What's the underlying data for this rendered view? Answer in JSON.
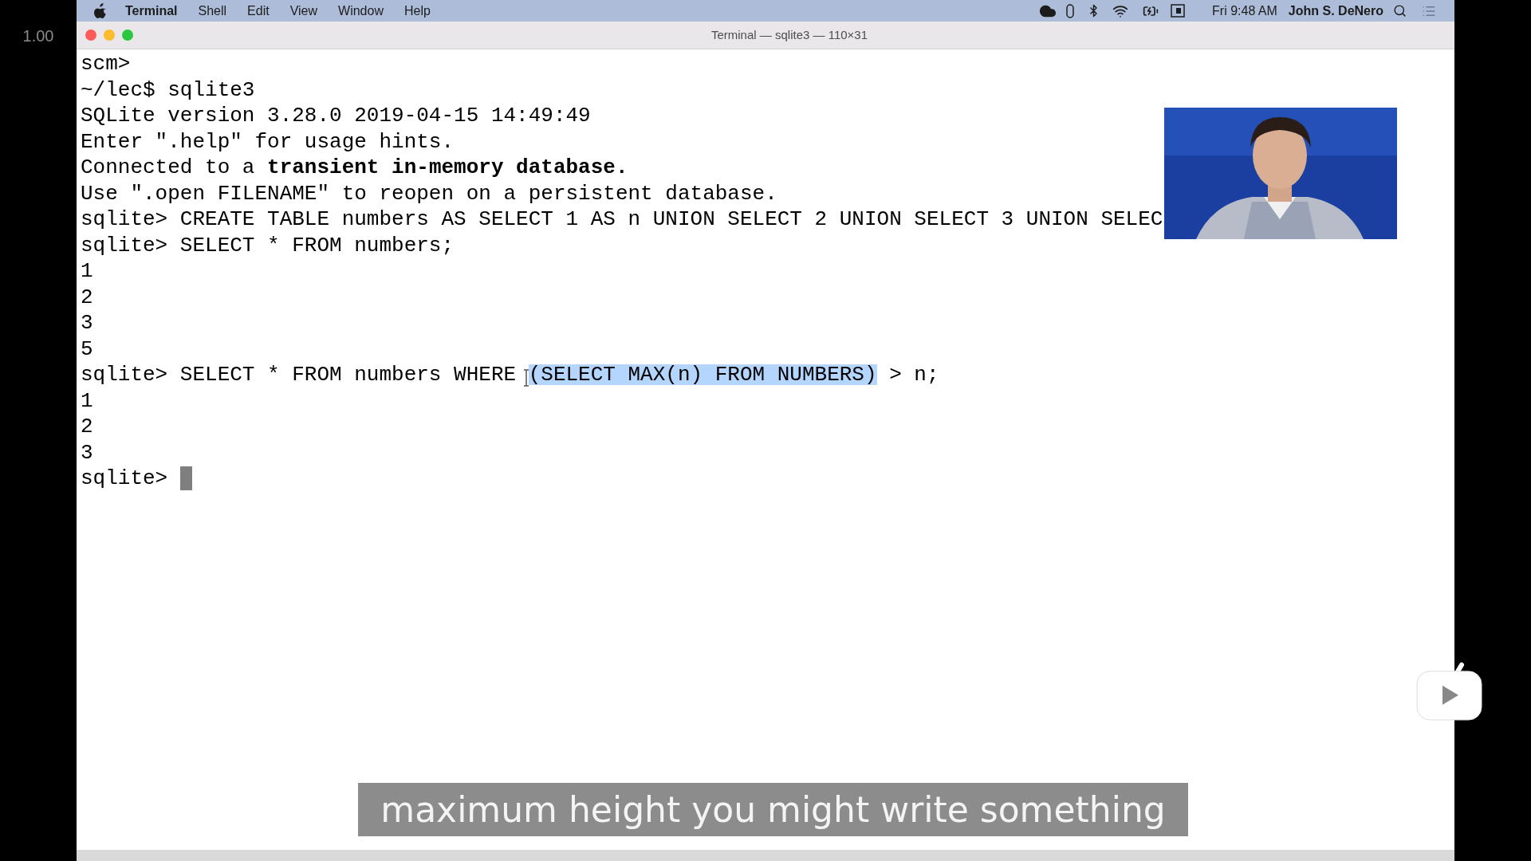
{
  "speed_label": "1.00",
  "menu_bar": {
    "app_name": "Terminal",
    "menus": [
      "Shell",
      "Edit",
      "View",
      "Window",
      "Help"
    ],
    "clock": "Fri 9:48 AM",
    "user": "John S. DeNero"
  },
  "window": {
    "title": "Terminal — sqlite3 — 110×31"
  },
  "terminal": {
    "lines": [
      {
        "text": "scm>"
      },
      {
        "text": "~/lec$ sqlite3"
      },
      {
        "text": "SQLite version 3.28.0 2019-04-15 14:49:49"
      },
      {
        "text": "Enter \".help\" for usage hints."
      },
      {
        "text": "Connected to a **transient in-memory database.**"
      },
      {
        "text": "Use \".open FILENAME\" to reopen on a persistent database."
      },
      {
        "text": "sqlite> CREATE TABLE numbers AS SELECT 1 AS n UNION SELECT 2 UNION SELECT 3 UNION SELEC"
      },
      {
        "text": "sqlite> SELECT * FROM numbers;"
      },
      {
        "text": "1"
      },
      {
        "text": "2"
      },
      {
        "text": "3"
      },
      {
        "text": "5"
      },
      {
        "segments": [
          {
            "text": "sqlite> SELECT * FROM numbers WHERE",
            "selected": false
          },
          {
            "text": "(SELECT MAX(n) FROM NUMBERS)",
            "selected": true
          },
          {
            "text": " > n;",
            "selected": false
          }
        ]
      },
      {
        "text": "1"
      },
      {
        "text": "2"
      },
      {
        "text": "3"
      },
      {
        "text": "sqlite> ",
        "cursor": true
      }
    ]
  },
  "caption": "maximum height you might write something"
}
